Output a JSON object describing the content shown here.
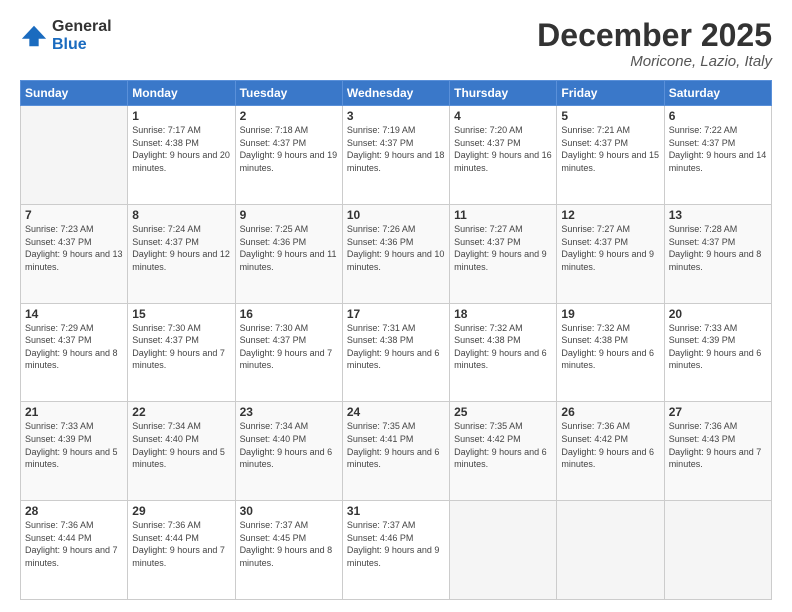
{
  "logo": {
    "general": "General",
    "blue": "Blue"
  },
  "header": {
    "month": "December 2025",
    "location": "Moricone, Lazio, Italy"
  },
  "days_of_week": [
    "Sunday",
    "Monday",
    "Tuesday",
    "Wednesday",
    "Thursday",
    "Friday",
    "Saturday"
  ],
  "weeks": [
    [
      {
        "day": "",
        "sunrise": "",
        "sunset": "",
        "daylight": ""
      },
      {
        "day": "1",
        "sunrise": "Sunrise: 7:17 AM",
        "sunset": "Sunset: 4:38 PM",
        "daylight": "Daylight: 9 hours and 20 minutes."
      },
      {
        "day": "2",
        "sunrise": "Sunrise: 7:18 AM",
        "sunset": "Sunset: 4:37 PM",
        "daylight": "Daylight: 9 hours and 19 minutes."
      },
      {
        "day": "3",
        "sunrise": "Sunrise: 7:19 AM",
        "sunset": "Sunset: 4:37 PM",
        "daylight": "Daylight: 9 hours and 18 minutes."
      },
      {
        "day": "4",
        "sunrise": "Sunrise: 7:20 AM",
        "sunset": "Sunset: 4:37 PM",
        "daylight": "Daylight: 9 hours and 16 minutes."
      },
      {
        "day": "5",
        "sunrise": "Sunrise: 7:21 AM",
        "sunset": "Sunset: 4:37 PM",
        "daylight": "Daylight: 9 hours and 15 minutes."
      },
      {
        "day": "6",
        "sunrise": "Sunrise: 7:22 AM",
        "sunset": "Sunset: 4:37 PM",
        "daylight": "Daylight: 9 hours and 14 minutes."
      }
    ],
    [
      {
        "day": "7",
        "sunrise": "Sunrise: 7:23 AM",
        "sunset": "Sunset: 4:37 PM",
        "daylight": "Daylight: 9 hours and 13 minutes."
      },
      {
        "day": "8",
        "sunrise": "Sunrise: 7:24 AM",
        "sunset": "Sunset: 4:37 PM",
        "daylight": "Daylight: 9 hours and 12 minutes."
      },
      {
        "day": "9",
        "sunrise": "Sunrise: 7:25 AM",
        "sunset": "Sunset: 4:36 PM",
        "daylight": "Daylight: 9 hours and 11 minutes."
      },
      {
        "day": "10",
        "sunrise": "Sunrise: 7:26 AM",
        "sunset": "Sunset: 4:36 PM",
        "daylight": "Daylight: 9 hours and 10 minutes."
      },
      {
        "day": "11",
        "sunrise": "Sunrise: 7:27 AM",
        "sunset": "Sunset: 4:37 PM",
        "daylight": "Daylight: 9 hours and 9 minutes."
      },
      {
        "day": "12",
        "sunrise": "Sunrise: 7:27 AM",
        "sunset": "Sunset: 4:37 PM",
        "daylight": "Daylight: 9 hours and 9 minutes."
      },
      {
        "day": "13",
        "sunrise": "Sunrise: 7:28 AM",
        "sunset": "Sunset: 4:37 PM",
        "daylight": "Daylight: 9 hours and 8 minutes."
      }
    ],
    [
      {
        "day": "14",
        "sunrise": "Sunrise: 7:29 AM",
        "sunset": "Sunset: 4:37 PM",
        "daylight": "Daylight: 9 hours and 8 minutes."
      },
      {
        "day": "15",
        "sunrise": "Sunrise: 7:30 AM",
        "sunset": "Sunset: 4:37 PM",
        "daylight": "Daylight: 9 hours and 7 minutes."
      },
      {
        "day": "16",
        "sunrise": "Sunrise: 7:30 AM",
        "sunset": "Sunset: 4:37 PM",
        "daylight": "Daylight: 9 hours and 7 minutes."
      },
      {
        "day": "17",
        "sunrise": "Sunrise: 7:31 AM",
        "sunset": "Sunset: 4:38 PM",
        "daylight": "Daylight: 9 hours and 6 minutes."
      },
      {
        "day": "18",
        "sunrise": "Sunrise: 7:32 AM",
        "sunset": "Sunset: 4:38 PM",
        "daylight": "Daylight: 9 hours and 6 minutes."
      },
      {
        "day": "19",
        "sunrise": "Sunrise: 7:32 AM",
        "sunset": "Sunset: 4:38 PM",
        "daylight": "Daylight: 9 hours and 6 minutes."
      },
      {
        "day": "20",
        "sunrise": "Sunrise: 7:33 AM",
        "sunset": "Sunset: 4:39 PM",
        "daylight": "Daylight: 9 hours and 6 minutes."
      }
    ],
    [
      {
        "day": "21",
        "sunrise": "Sunrise: 7:33 AM",
        "sunset": "Sunset: 4:39 PM",
        "daylight": "Daylight: 9 hours and 5 minutes."
      },
      {
        "day": "22",
        "sunrise": "Sunrise: 7:34 AM",
        "sunset": "Sunset: 4:40 PM",
        "daylight": "Daylight: 9 hours and 5 minutes."
      },
      {
        "day": "23",
        "sunrise": "Sunrise: 7:34 AM",
        "sunset": "Sunset: 4:40 PM",
        "daylight": "Daylight: 9 hours and 6 minutes."
      },
      {
        "day": "24",
        "sunrise": "Sunrise: 7:35 AM",
        "sunset": "Sunset: 4:41 PM",
        "daylight": "Daylight: 9 hours and 6 minutes."
      },
      {
        "day": "25",
        "sunrise": "Sunrise: 7:35 AM",
        "sunset": "Sunset: 4:42 PM",
        "daylight": "Daylight: 9 hours and 6 minutes."
      },
      {
        "day": "26",
        "sunrise": "Sunrise: 7:36 AM",
        "sunset": "Sunset: 4:42 PM",
        "daylight": "Daylight: 9 hours and 6 minutes."
      },
      {
        "day": "27",
        "sunrise": "Sunrise: 7:36 AM",
        "sunset": "Sunset: 4:43 PM",
        "daylight": "Daylight: 9 hours and 7 minutes."
      }
    ],
    [
      {
        "day": "28",
        "sunrise": "Sunrise: 7:36 AM",
        "sunset": "Sunset: 4:44 PM",
        "daylight": "Daylight: 9 hours and 7 minutes."
      },
      {
        "day": "29",
        "sunrise": "Sunrise: 7:36 AM",
        "sunset": "Sunset: 4:44 PM",
        "daylight": "Daylight: 9 hours and 7 minutes."
      },
      {
        "day": "30",
        "sunrise": "Sunrise: 7:37 AM",
        "sunset": "Sunset: 4:45 PM",
        "daylight": "Daylight: 9 hours and 8 minutes."
      },
      {
        "day": "31",
        "sunrise": "Sunrise: 7:37 AM",
        "sunset": "Sunset: 4:46 PM",
        "daylight": "Daylight: 9 hours and 9 minutes."
      },
      {
        "day": "",
        "sunrise": "",
        "sunset": "",
        "daylight": ""
      },
      {
        "day": "",
        "sunrise": "",
        "sunset": "",
        "daylight": ""
      },
      {
        "day": "",
        "sunrise": "",
        "sunset": "",
        "daylight": ""
      }
    ]
  ]
}
